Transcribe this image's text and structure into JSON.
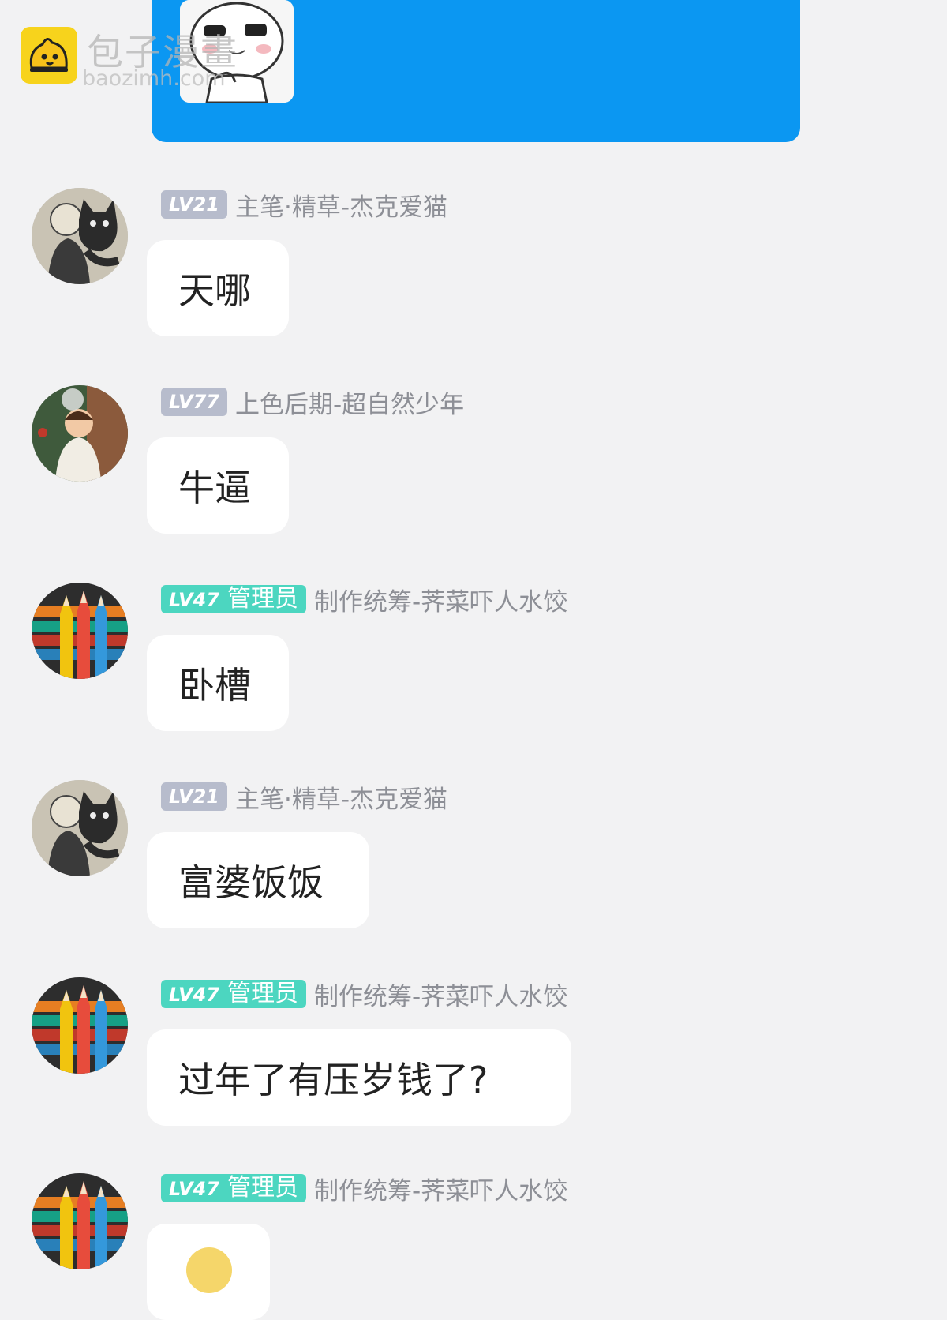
{
  "watermark": {
    "title": "包子漫畫",
    "url": "baozimh.com"
  },
  "messages": [
    {
      "level": "LV21",
      "role": "",
      "name": "主笔·精草-杰克爱猫",
      "text": "天哪",
      "avatar": "cat-holding-avatar"
    },
    {
      "level": "LV77",
      "role": "",
      "name": "上色后期-超自然少年",
      "text": "牛逼",
      "avatar": "boy-illustration-avatar"
    },
    {
      "level": "LV47",
      "role": "管理员",
      "name": "制作统筹-荠菜吓人水饺",
      "text": "卧槽",
      "avatar": "colored-pencils-avatar"
    },
    {
      "level": "LV21",
      "role": "",
      "name": "主笔·精草-杰克爱猫",
      "text": "富婆饭饭",
      "avatar": "cat-holding-avatar"
    },
    {
      "level": "LV47",
      "role": "管理员",
      "name": "制作统筹-荠菜吓人水饺",
      "text": "过年了有压岁钱了?",
      "avatar": "colored-pencils-avatar"
    },
    {
      "level": "LV47",
      "role": "管理员",
      "name": "制作统筹-荠菜吓人水饺",
      "text": "",
      "avatar": "colored-pencils-avatar"
    }
  ],
  "colors": {
    "accent_blue": "#0b97f2",
    "admin_badge": "#4cd6c0",
    "level_badge": "#b7bccc",
    "background": "#f2f2f3"
  }
}
